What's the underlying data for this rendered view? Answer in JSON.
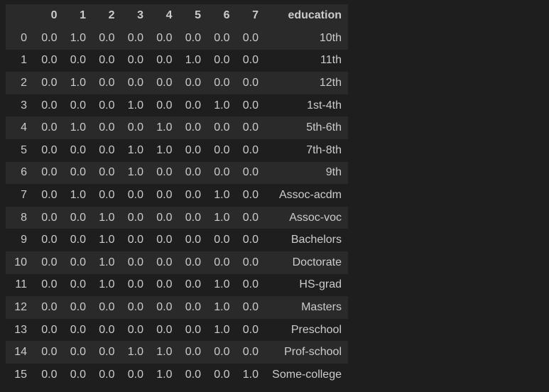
{
  "table": {
    "columns": [
      "0",
      "1",
      "2",
      "3",
      "4",
      "5",
      "6",
      "7",
      "education"
    ],
    "rows": [
      {
        "index": "0",
        "values": [
          "0.0",
          "1.0",
          "0.0",
          "0.0",
          "0.0",
          "0.0",
          "0.0",
          "0.0"
        ],
        "education": "10th"
      },
      {
        "index": "1",
        "values": [
          "0.0",
          "0.0",
          "0.0",
          "0.0",
          "0.0",
          "1.0",
          "0.0",
          "0.0"
        ],
        "education": "11th"
      },
      {
        "index": "2",
        "values": [
          "0.0",
          "1.0",
          "0.0",
          "0.0",
          "0.0",
          "0.0",
          "0.0",
          "0.0"
        ],
        "education": "12th"
      },
      {
        "index": "3",
        "values": [
          "0.0",
          "0.0",
          "0.0",
          "1.0",
          "0.0",
          "0.0",
          "1.0",
          "0.0"
        ],
        "education": "1st-4th"
      },
      {
        "index": "4",
        "values": [
          "0.0",
          "1.0",
          "0.0",
          "0.0",
          "1.0",
          "0.0",
          "0.0",
          "0.0"
        ],
        "education": "5th-6th"
      },
      {
        "index": "5",
        "values": [
          "0.0",
          "0.0",
          "0.0",
          "1.0",
          "1.0",
          "0.0",
          "0.0",
          "0.0"
        ],
        "education": "7th-8th"
      },
      {
        "index": "6",
        "values": [
          "0.0",
          "0.0",
          "0.0",
          "1.0",
          "0.0",
          "0.0",
          "0.0",
          "0.0"
        ],
        "education": "9th"
      },
      {
        "index": "7",
        "values": [
          "0.0",
          "1.0",
          "0.0",
          "0.0",
          "0.0",
          "0.0",
          "1.0",
          "0.0"
        ],
        "education": "Assoc-acdm"
      },
      {
        "index": "8",
        "values": [
          "0.0",
          "0.0",
          "1.0",
          "0.0",
          "0.0",
          "0.0",
          "1.0",
          "0.0"
        ],
        "education": "Assoc-voc"
      },
      {
        "index": "9",
        "values": [
          "0.0",
          "0.0",
          "1.0",
          "0.0",
          "0.0",
          "0.0",
          "0.0",
          "0.0"
        ],
        "education": "Bachelors"
      },
      {
        "index": "10",
        "values": [
          "0.0",
          "0.0",
          "1.0",
          "0.0",
          "0.0",
          "0.0",
          "0.0",
          "0.0"
        ],
        "education": "Doctorate"
      },
      {
        "index": "11",
        "values": [
          "0.0",
          "0.0",
          "1.0",
          "0.0",
          "0.0",
          "0.0",
          "1.0",
          "0.0"
        ],
        "education": "HS-grad"
      },
      {
        "index": "12",
        "values": [
          "0.0",
          "0.0",
          "0.0",
          "0.0",
          "0.0",
          "0.0",
          "1.0",
          "0.0"
        ],
        "education": "Masters"
      },
      {
        "index": "13",
        "values": [
          "0.0",
          "0.0",
          "0.0",
          "0.0",
          "0.0",
          "0.0",
          "1.0",
          "0.0"
        ],
        "education": "Preschool"
      },
      {
        "index": "14",
        "values": [
          "0.0",
          "0.0",
          "0.0",
          "1.0",
          "1.0",
          "0.0",
          "0.0",
          "0.0"
        ],
        "education": "Prof-school"
      },
      {
        "index": "15",
        "values": [
          "0.0",
          "0.0",
          "0.0",
          "0.0",
          "1.0",
          "0.0",
          "0.0",
          "1.0"
        ],
        "education": "Some-college"
      }
    ]
  },
  "colors": {
    "background": "#1e1e1e",
    "row_stripe": "#2a2a2a",
    "text": "#cccccc"
  }
}
